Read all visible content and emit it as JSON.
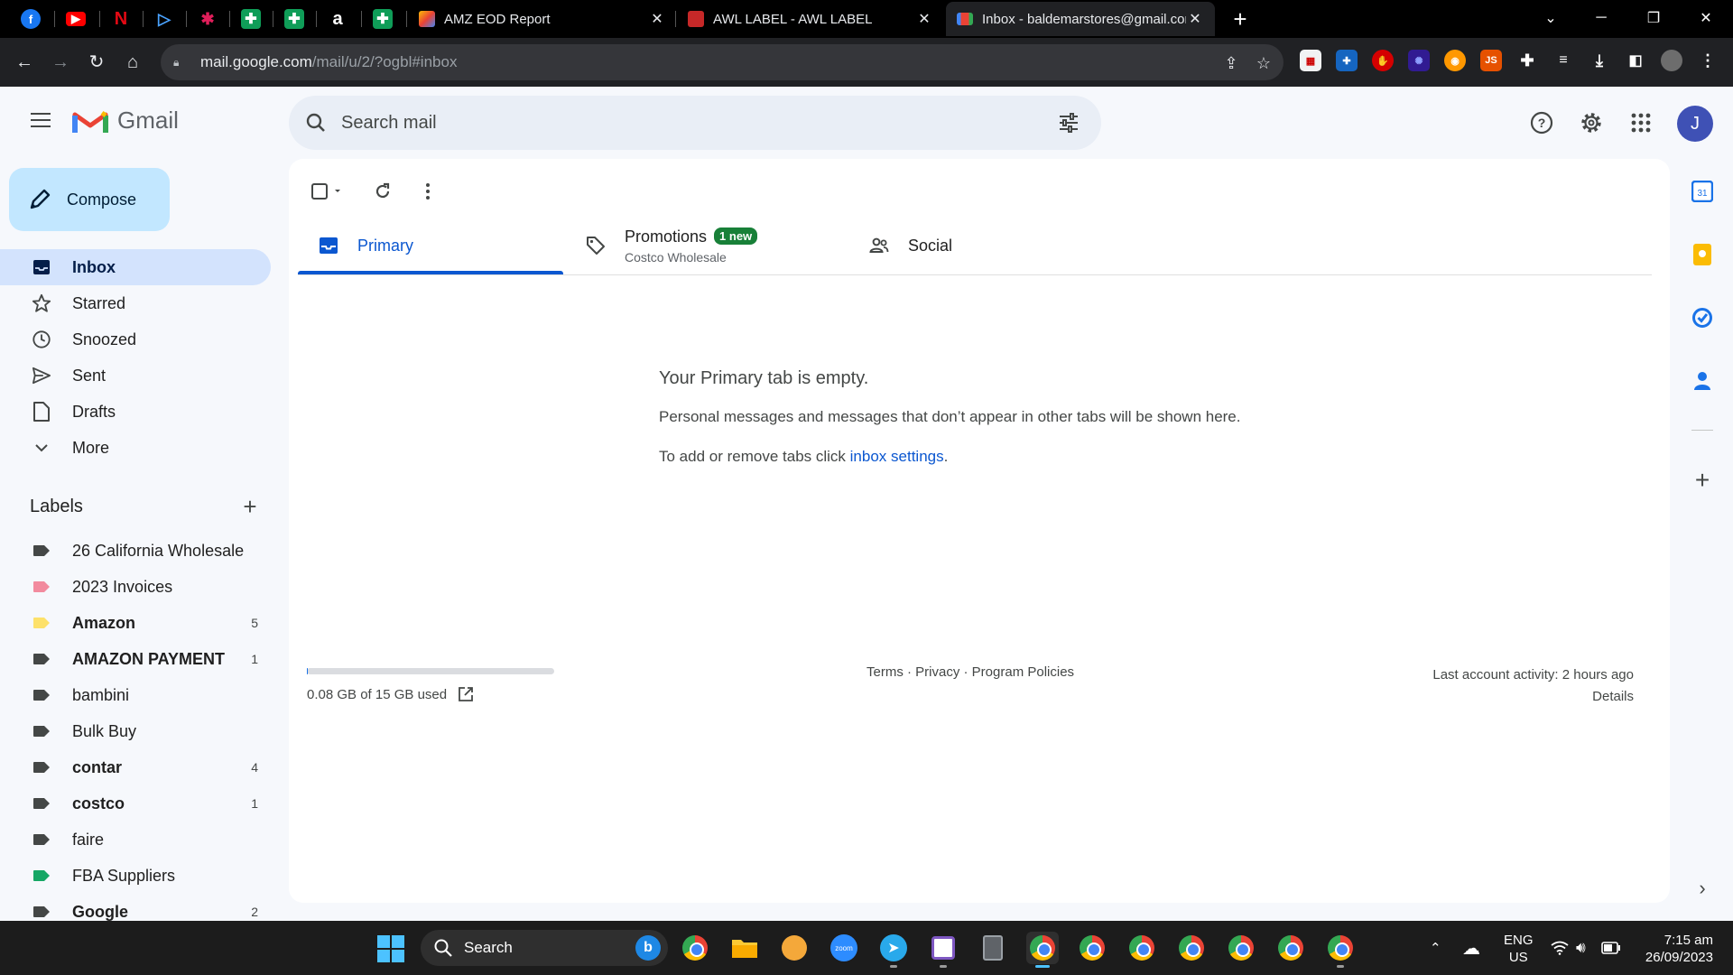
{
  "browser": {
    "tabs": [
      {
        "title": "AMZ EOD Report"
      },
      {
        "title": "AWL LABEL - AWL LABEL"
      },
      {
        "title": "Inbox - baldemarstores@gmail.com"
      }
    ],
    "url_host": "mail.google.com",
    "url_path": "/mail/u/2/?ogbl#inbox"
  },
  "gmail": {
    "logo_text": "Gmail",
    "search_placeholder": "Search mail",
    "avatar_letter": "J",
    "compose_label": "Compose",
    "nav": [
      {
        "label": "Inbox"
      },
      {
        "label": "Starred"
      },
      {
        "label": "Snoozed"
      },
      {
        "label": "Sent"
      },
      {
        "label": "Drafts"
      },
      {
        "label": "More"
      }
    ],
    "labels_heading": "Labels",
    "labels": [
      {
        "name": "26 California Wholesale",
        "count": "",
        "color": "#444746"
      },
      {
        "name": "2023 Invoices",
        "count": "",
        "color": "#f28b9e"
      },
      {
        "name": "Amazon",
        "count": "5",
        "color": "#fde16a"
      },
      {
        "name": "AMAZON PAYMENT",
        "count": "1",
        "color": "#444746"
      },
      {
        "name": "bambini",
        "count": "",
        "color": "#444746"
      },
      {
        "name": "Bulk Buy",
        "count": "",
        "color": "#444746"
      },
      {
        "name": "contar",
        "count": "4",
        "color": "#444746"
      },
      {
        "name": "costco",
        "count": "1",
        "color": "#444746"
      },
      {
        "name": "faire",
        "count": "",
        "color": "#444746"
      },
      {
        "name": "FBA Suppliers",
        "count": "",
        "color": "#16a765"
      },
      {
        "name": "Google",
        "count": "2",
        "color": "#444746"
      }
    ],
    "tabs": {
      "primary": "Primary",
      "promotions": "Promotions",
      "promotions_badge": "1 new",
      "promotions_sub": "Costco Wholesale",
      "social": "Social"
    },
    "empty": {
      "title": "Your Primary tab is empty.",
      "line1": "Personal messages and messages that don’t appear in other tabs will be shown here.",
      "line2_prefix": "To add or remove tabs click ",
      "line2_link": "inbox settings",
      "line2_suffix": "."
    },
    "footer": {
      "storage": "0.08 GB of 15 GB used",
      "storage_fraction": 0.005,
      "links": "Terms · Privacy · Program Policies",
      "activity": "Last account activity: 2 hours ago",
      "details": "Details"
    },
    "accent": "#0b57d0"
  },
  "taskbar": {
    "search_label": "Search",
    "lang_top": "ENG",
    "lang_bottom": "US",
    "time": "7:15 am",
    "date": "26/09/2023"
  }
}
